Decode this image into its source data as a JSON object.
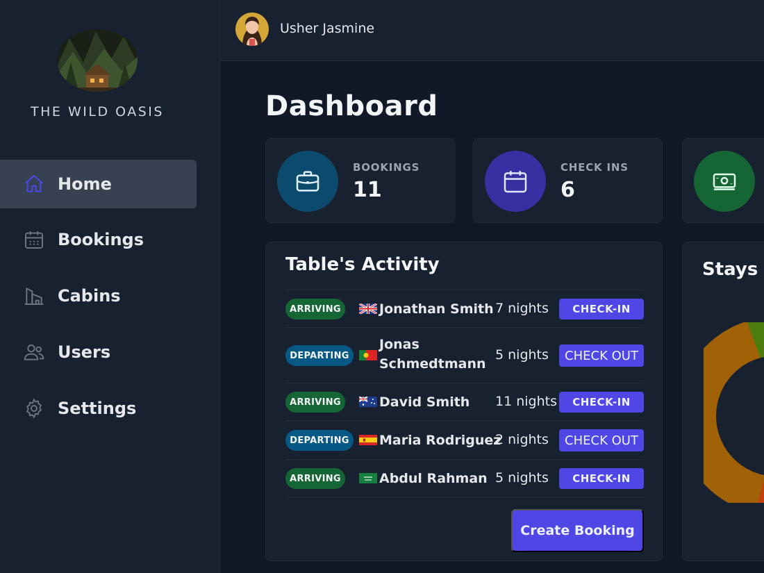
{
  "brand": {
    "name": "THE WILD OASIS"
  },
  "user": {
    "name": "Usher Jasmine"
  },
  "sidebar": {
    "items": [
      {
        "label": "Home",
        "icon": "home-icon",
        "active": true
      },
      {
        "label": "Bookings",
        "icon": "calendar-icon",
        "active": false
      },
      {
        "label": "Cabins",
        "icon": "building-icon",
        "active": false
      },
      {
        "label": "Users",
        "icon": "users-icon",
        "active": false
      },
      {
        "label": "Settings",
        "icon": "gear-icon",
        "active": false
      }
    ]
  },
  "page": {
    "title": "Dashboard"
  },
  "stats": [
    {
      "label": "BOOKINGS",
      "value": "11",
      "icon": "briefcase-icon",
      "color": "#0c4a6e"
    },
    {
      "label": "CHECK INS",
      "value": "6",
      "icon": "calendar-icon",
      "color": "#3730a3"
    },
    {
      "label": "",
      "value": "",
      "icon": "banknotes-icon",
      "color": "#166534"
    }
  ],
  "activity": {
    "title": "Table's Activity",
    "rows": [
      {
        "status": "ARRIVING",
        "flag": "gb",
        "guest": "Jonathan Smith",
        "nights": "7 nights",
        "action": "CHECK-IN"
      },
      {
        "status": "DEPARTING",
        "flag": "pt",
        "guest": "Jonas Schmedtmann",
        "nights": "5 nights",
        "action": "CHECK OUT"
      },
      {
        "status": "ARRIVING",
        "flag": "au",
        "guest": "David Smith",
        "nights": "11 nights",
        "action": "CHECK-IN"
      },
      {
        "status": "DEPARTING",
        "flag": "es",
        "guest": "Maria Rodriguez",
        "nights": "2 nights",
        "action": "CHECK OUT"
      },
      {
        "status": "ARRIVING",
        "flag": "sa",
        "guest": "Abdul Rahman",
        "nights": "5 nights",
        "action": "CHECK-IN"
      }
    ],
    "create_label": "Create Booking"
  },
  "stays": {
    "title": "Stays D",
    "colors": {
      "orange": "#a16207",
      "green": "#4d7c0f",
      "red": "#c2410c"
    }
  },
  "colors": {
    "accent": "#4f46e5",
    "arriving": "#166534",
    "departing": "#075985"
  }
}
